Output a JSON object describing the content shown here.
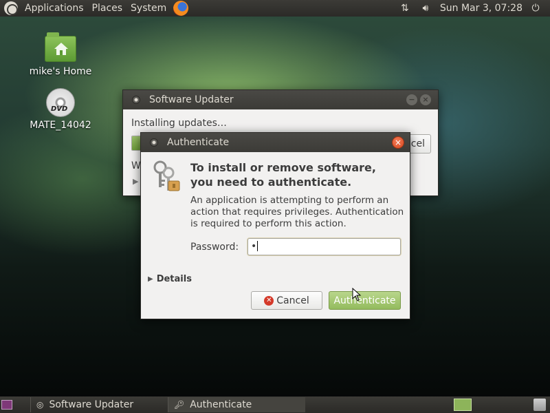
{
  "top_panel": {
    "menu_applications": "Applications",
    "menu_places": "Places",
    "menu_system": "System",
    "clock": "Sun Mar  3, 07:28",
    "icons": [
      "ubuntu-logo",
      "firefox",
      "network-transfer",
      "volume",
      "power"
    ]
  },
  "desktop": {
    "home_label": "mike's Home",
    "dvd_label": "MATE_14042",
    "dvd_text": "DVD"
  },
  "updater": {
    "title": "Software Updater",
    "status": "Installing updates…",
    "progress_fraction": 0.12,
    "cancel_label": "cel",
    "partial_text": "W"
  },
  "auth": {
    "title": "Authenticate",
    "heading_line1": "To install or remove software,",
    "heading_line2": "you need to authenticate.",
    "message": "An application is attempting to perform an action that requires privileges. Authentication is required to perform this action.",
    "password_label": "Password:",
    "password_value": "•",
    "details_label": "Details",
    "cancel_label": "Cancel",
    "authenticate_label": "Authenticate"
  },
  "bottom_panel": {
    "task_updater": "Software Updater",
    "task_authenticate": "Authenticate"
  },
  "colors": {
    "panel": "#3c3b37",
    "accent_green": "#93bb5d",
    "close_orange": "#d84a21"
  }
}
